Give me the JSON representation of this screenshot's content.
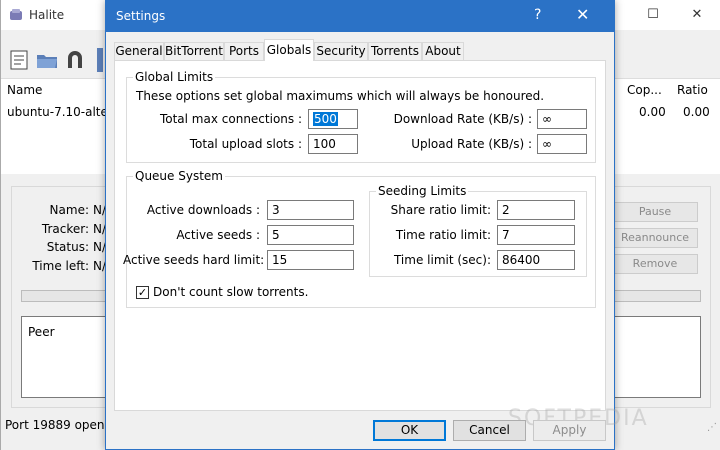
{
  "main": {
    "title": "Halite",
    "window_buttons": {
      "minimize": "—",
      "maximize": "☐",
      "close": "✕"
    },
    "columns": {
      "name": "Name",
      "copies": "Cop...",
      "ratio": "Ratio"
    },
    "row": {
      "name": "ubuntu-7.10-altern",
      "copies": "0.00",
      "ratio": "0.00"
    },
    "details": {
      "name_label": "Name:",
      "name_value": "N/",
      "tracker_label": "Tracker:",
      "tracker_value": "N/",
      "status_label": "Status:",
      "status_value": "N/",
      "time_left_label": "Time left:",
      "time_left_value": "N/"
    },
    "buttons": {
      "pause": "Pause",
      "reannounce": "Reannounce",
      "remove": "Remove"
    },
    "peer_header": "Peer",
    "status": "Port 19889 open"
  },
  "dialog": {
    "title": "Settings",
    "help": "?",
    "close": "✕",
    "tabs": [
      "General",
      "BitTorrent",
      "Ports",
      "Globals",
      "Security",
      "Torrents",
      "About"
    ],
    "active_tab": "Globals",
    "global_limits": {
      "title": "Global Limits",
      "description": "These options set global maximums which will always be honoured.",
      "total_max_connections_label": "Total max connections :",
      "total_max_connections": "500",
      "total_upload_slots_label": "Total upload slots :",
      "total_upload_slots": "100",
      "download_rate_label": "Download Rate (KB/s) :",
      "download_rate": "∞",
      "upload_rate_label": "Upload Rate (KB/s) :",
      "upload_rate": "∞"
    },
    "queue_system": {
      "title": "Queue System",
      "active_downloads_label": "Active downloads :",
      "active_downloads": "3",
      "active_seeds_label": "Active seeds :",
      "active_seeds": "5",
      "active_seeds_hard_limit_label": "Active seeds hard limit:",
      "active_seeds_hard_limit": "15",
      "slow_torrents_label": "Don't count slow torrents.",
      "slow_torrents_checked": true
    },
    "seeding_limits": {
      "title": "Seeding Limits",
      "share_ratio_label": "Share ratio limit:",
      "share_ratio": "2",
      "time_ratio_label": "Time ratio limit:",
      "time_ratio": "7",
      "time_limit_label": "Time limit (sec):",
      "time_limit": "86400"
    },
    "buttons": {
      "ok": "OK",
      "cancel": "Cancel",
      "apply": "Apply"
    }
  },
  "watermark": "SOFTPEDIA"
}
